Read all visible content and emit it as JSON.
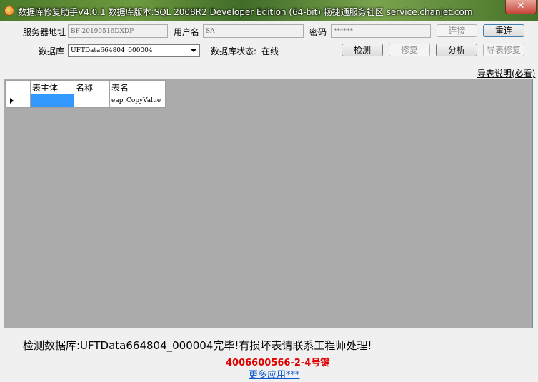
{
  "window": {
    "title": "数据库修复助手V4.0.1 数据库版本:SQL 2008R2 Developer Edition (64-bit)  畅捷通服务社区 service.chanjet.com",
    "close_symbol": "✕"
  },
  "connection": {
    "server_label": "服务器地址",
    "server_value": "BF-20190516DXDP",
    "user_label": "用户名",
    "user_value": "SA",
    "password_label": "密码",
    "password_value": "******",
    "connect_button": "连接",
    "reconnect_button": "重连"
  },
  "database": {
    "label": "数据库",
    "selected": "UFTData664804_000004",
    "status_label": "数据库状态:",
    "status_value": "在线",
    "check_button": "检测",
    "repair_button": "修复",
    "analyze_button": "分析",
    "export_repair_button": "导表修复"
  },
  "export_help_link": "导表说明(必看)",
  "grid": {
    "columns": [
      "表主体",
      "名称",
      "表名"
    ],
    "rows": [
      {
        "table_owner": "",
        "name": "",
        "table_name": "eap_CopyValue"
      }
    ]
  },
  "footer": {
    "status_message": "检测数据库:UFTData664804_000004完毕!有损坏表请联系工程师处理!",
    "phone": "4006600566-2-4号键",
    "more_apps": "更多应用***"
  },
  "colors": {
    "phone": "#e00000",
    "more_apps_link": "#0a58d0",
    "selected_cell": "#3399ff",
    "grid_background": "#ababab"
  }
}
